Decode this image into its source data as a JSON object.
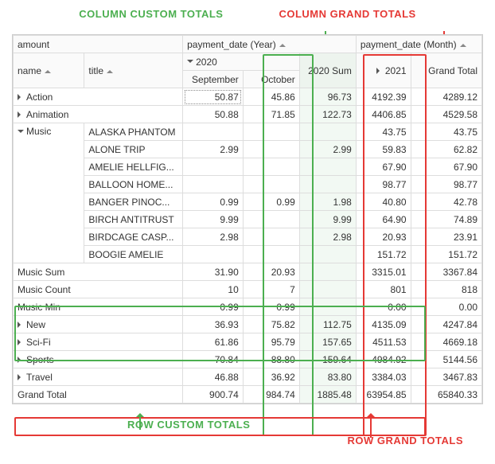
{
  "labels": {
    "col_custom": "COLUMN CUSTOM TOTALS",
    "col_grand": "COLUMN GRAND TOTALS",
    "row_custom": "ROW CUSTOM TOTALS",
    "row_grand": "ROW GRAND TOTALS"
  },
  "measure": "amount",
  "col_fields": {
    "year": "payment_date (Year)",
    "month": "payment_date (Month)"
  },
  "row_fields": {
    "name": "name",
    "title": "title"
  },
  "year_headers": {
    "y2020": "2020",
    "y2020sum": "2020 Sum",
    "y2021": "2021",
    "grand": "Grand Total"
  },
  "month_headers": {
    "sep": "September",
    "oct": "October"
  },
  "rows": {
    "action": {
      "name": "Action",
      "sep": "50.87",
      "oct": "45.86",
      "sum20": "96.73",
      "y2021": "4192.39",
      "gt": "4289.12"
    },
    "animation": {
      "name": "Animation",
      "sep": "50.88",
      "oct": "71.85",
      "sum20": "122.73",
      "y2021": "4406.85",
      "gt": "4529.58"
    },
    "music": {
      "name": "Music"
    },
    "music_items": [
      {
        "title": "ALASKA PHANTOM",
        "sep": "",
        "oct": "",
        "sum20": "",
        "y2021": "43.75",
        "gt": "43.75"
      },
      {
        "title": "ALONE TRIP",
        "sep": "2.99",
        "oct": "",
        "sum20": "2.99",
        "y2021": "59.83",
        "gt": "62.82"
      },
      {
        "title": "AMELIE HELLFIG...",
        "sep": "",
        "oct": "",
        "sum20": "",
        "y2021": "67.90",
        "gt": "67.90"
      },
      {
        "title": "BALLOON HOME...",
        "sep": "",
        "oct": "",
        "sum20": "",
        "y2021": "98.77",
        "gt": "98.77"
      },
      {
        "title": "BANGER PINOC...",
        "sep": "0.99",
        "oct": "0.99",
        "sum20": "1.98",
        "y2021": "40.80",
        "gt": "42.78"
      },
      {
        "title": "BIRCH ANTITRUST",
        "sep": "9.99",
        "oct": "",
        "sum20": "9.99",
        "y2021": "64.90",
        "gt": "74.89"
      },
      {
        "title": "BIRDCAGE CASP...",
        "sep": "2.98",
        "oct": "",
        "sum20": "2.98",
        "y2021": "20.93",
        "gt": "23.91"
      },
      {
        "title": "BOOGIE AMELIE",
        "sep": "",
        "oct": "",
        "sum20": "",
        "y2021": "151.72",
        "gt": "151.72"
      }
    ],
    "music_sum": {
      "label": "Music Sum",
      "sep": "31.90",
      "oct": "20.93",
      "sum20": "",
      "y2021": "3315.01",
      "gt": "3367.84"
    },
    "music_count": {
      "label": "Music Count",
      "sep": "10",
      "oct": "7",
      "sum20": "",
      "y2021": "801",
      "gt": "818"
    },
    "music_min": {
      "label": "Music Min",
      "sep": "0.99",
      "oct": "0.99",
      "sum20": "",
      "y2021": "0.00",
      "gt": "0.00"
    },
    "new": {
      "name": "New",
      "sep": "36.93",
      "oct": "75.82",
      "sum20": "112.75",
      "y2021": "4135.09",
      "gt": "4247.84"
    },
    "scifi": {
      "name": "Sci-Fi",
      "sep": "61.86",
      "oct": "95.79",
      "sum20": "157.65",
      "y2021": "4511.53",
      "gt": "4669.18"
    },
    "sports": {
      "name": "Sports",
      "sep": "70.84",
      "oct": "88.80",
      "sum20": "159.64",
      "y2021": "4984.92",
      "gt": "5144.56"
    },
    "travel": {
      "name": "Travel",
      "sep": "46.88",
      "oct": "36.92",
      "sum20": "83.80",
      "y2021": "3384.03",
      "gt": "3467.83"
    },
    "grand": {
      "label": "Grand Total",
      "sep": "900.74",
      "oct": "984.74",
      "sum20": "1885.48",
      "y2021": "63954.85",
      "gt": "65840.33"
    }
  }
}
